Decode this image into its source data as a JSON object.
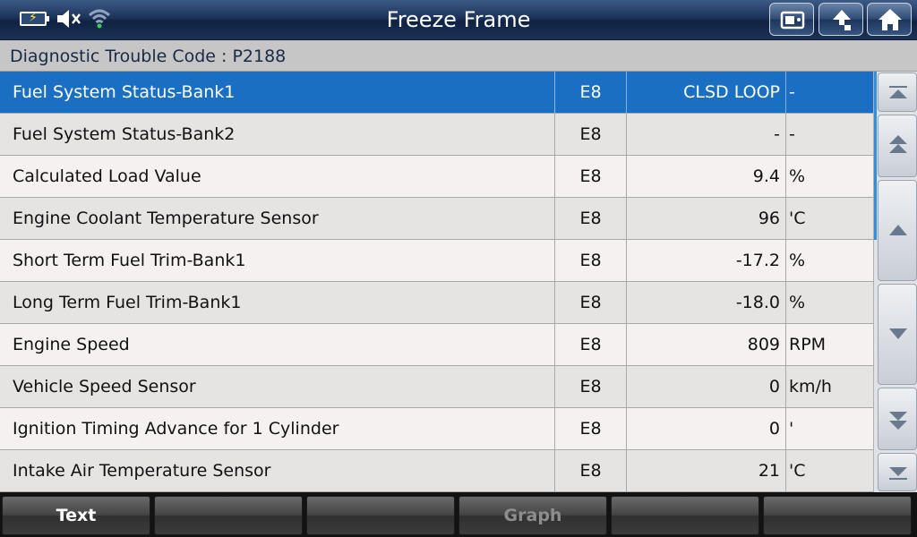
{
  "header": {
    "title": "Freeze Frame",
    "status_icons": [
      "battery-charging-icon",
      "speaker-muted-icon",
      "wifi-icon"
    ],
    "buttons": [
      "screenshot-button",
      "back-button",
      "home-button"
    ]
  },
  "dtc": {
    "label": "Diagnostic Trouble Code : P2188"
  },
  "table": {
    "rows": [
      {
        "name": "Fuel System Status-Bank1",
        "module": "E8",
        "value": "CLSD LOOP",
        "unit": "-",
        "selected": true
      },
      {
        "name": "Fuel System Status-Bank2",
        "module": "E8",
        "value": "-",
        "unit": "-"
      },
      {
        "name": "Calculated Load Value",
        "module": "E8",
        "value": "9.4",
        "unit": "%"
      },
      {
        "name": "Engine Coolant Temperature Sensor",
        "module": "E8",
        "value": "96",
        "unit": "'C"
      },
      {
        "name": "Short Term Fuel Trim-Bank1",
        "module": "E8",
        "value": "-17.2",
        "unit": "%"
      },
      {
        "name": "Long Term Fuel Trim-Bank1",
        "module": "E8",
        "value": "-18.0",
        "unit": "%"
      },
      {
        "name": "Engine Speed",
        "module": "E8",
        "value": "809",
        "unit": "RPM"
      },
      {
        "name": "Vehicle Speed Sensor",
        "module": "E8",
        "value": "0",
        "unit": "km/h"
      },
      {
        "name": "Ignition Timing Advance for 1 Cylinder",
        "module": "E8",
        "value": "0",
        "unit": "'"
      },
      {
        "name": "Intake Air Temperature Sensor",
        "module": "E8",
        "value": "21",
        "unit": "'C"
      }
    ]
  },
  "scrollbar": {
    "buttons": [
      "scroll-top",
      "page-up",
      "line-up",
      "line-down",
      "page-down",
      "scroll-bottom"
    ]
  },
  "footer": {
    "buttons": [
      {
        "label": "Text",
        "enabled": true
      },
      {
        "label": "",
        "enabled": true
      },
      {
        "label": "",
        "enabled": true
      },
      {
        "label": "Graph",
        "enabled": false
      },
      {
        "label": "",
        "enabled": true
      },
      {
        "label": "",
        "enabled": true
      }
    ]
  },
  "colors": {
    "header_dark": "#0f2244",
    "selected_row": "#1a6fc2",
    "dtc_bar": "#c6c6c6",
    "footer": "#121212"
  }
}
